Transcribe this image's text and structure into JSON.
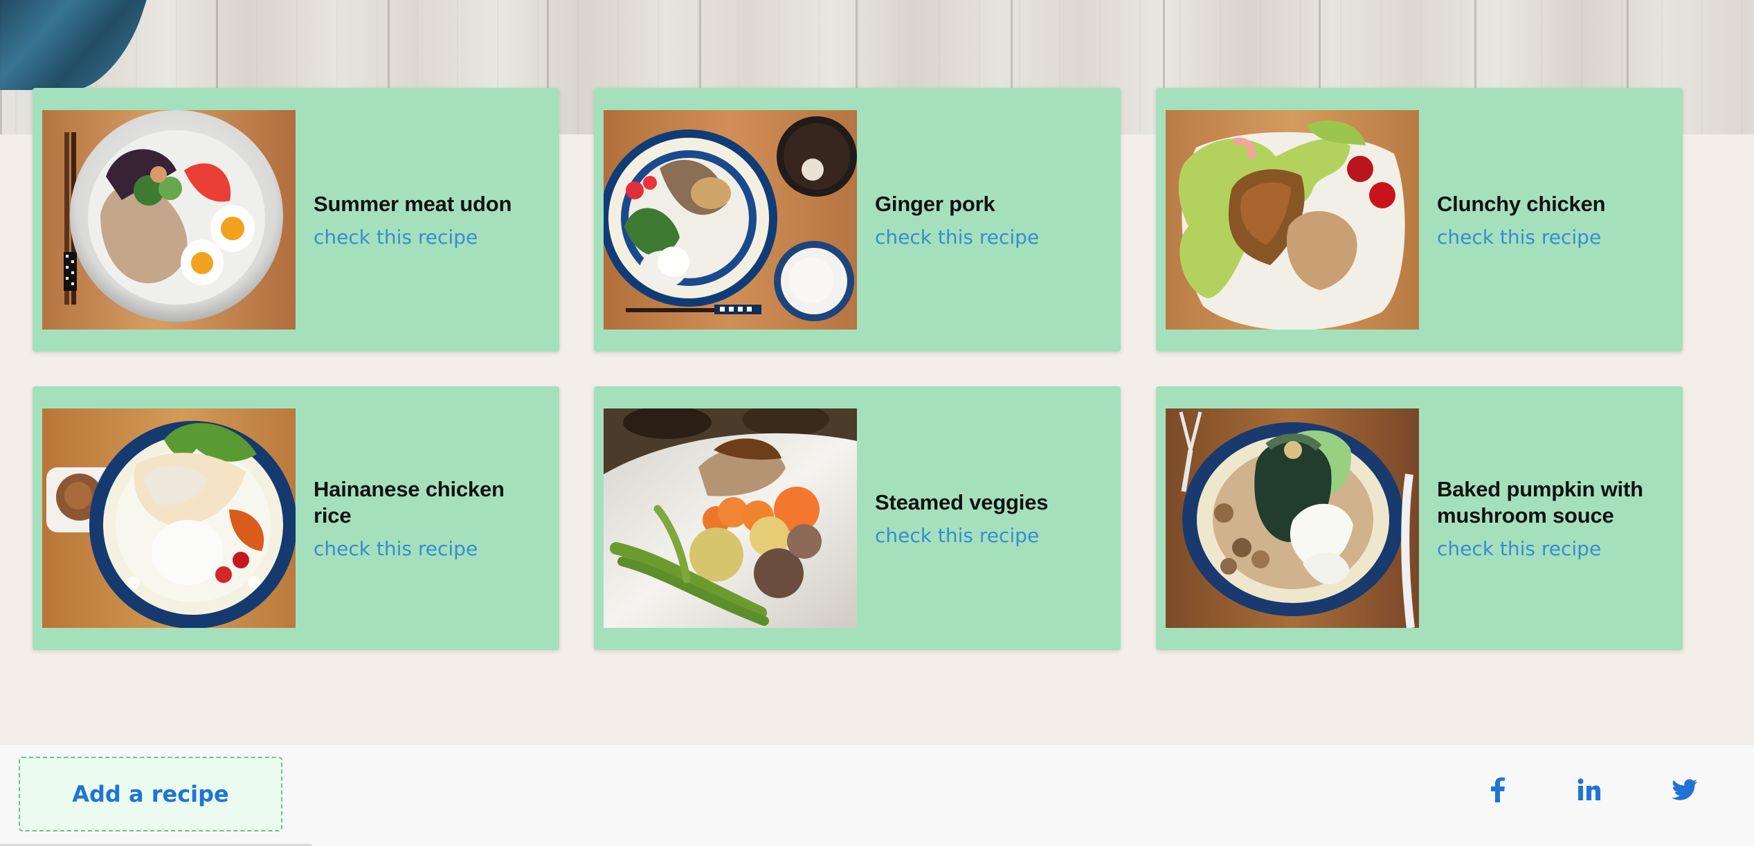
{
  "recipes": [
    {
      "title": "Summer meat udon",
      "link_text": "check this recipe",
      "image_alt": "udon bowl"
    },
    {
      "title": "Ginger pork",
      "link_text": "check this recipe",
      "image_alt": "ginger pork plate"
    },
    {
      "title": "Clunchy chicken",
      "link_text": "check this recipe",
      "image_alt": "crunchy chicken plate"
    },
    {
      "title": "Hainanese chicken rice",
      "link_text": "check this recipe",
      "image_alt": "chicken rice plate"
    },
    {
      "title": "Steamed veggies",
      "link_text": "check this recipe",
      "image_alt": "steamed vegetables plate"
    },
    {
      "title": "Baked pumpkin with mushroom souce",
      "link_text": "check this recipe",
      "image_alt": "baked pumpkin plate"
    }
  ],
  "footer": {
    "add_recipe_label": "Add a recipe",
    "social_icons": [
      "facebook-icon",
      "linkedin-icon",
      "twitter-icon"
    ]
  },
  "colors": {
    "card_background": "#a5e0bd",
    "link": "#398bd1",
    "button_text": "#1f74d3",
    "button_border": "#63c68b",
    "page_background": "#f3eee7"
  }
}
